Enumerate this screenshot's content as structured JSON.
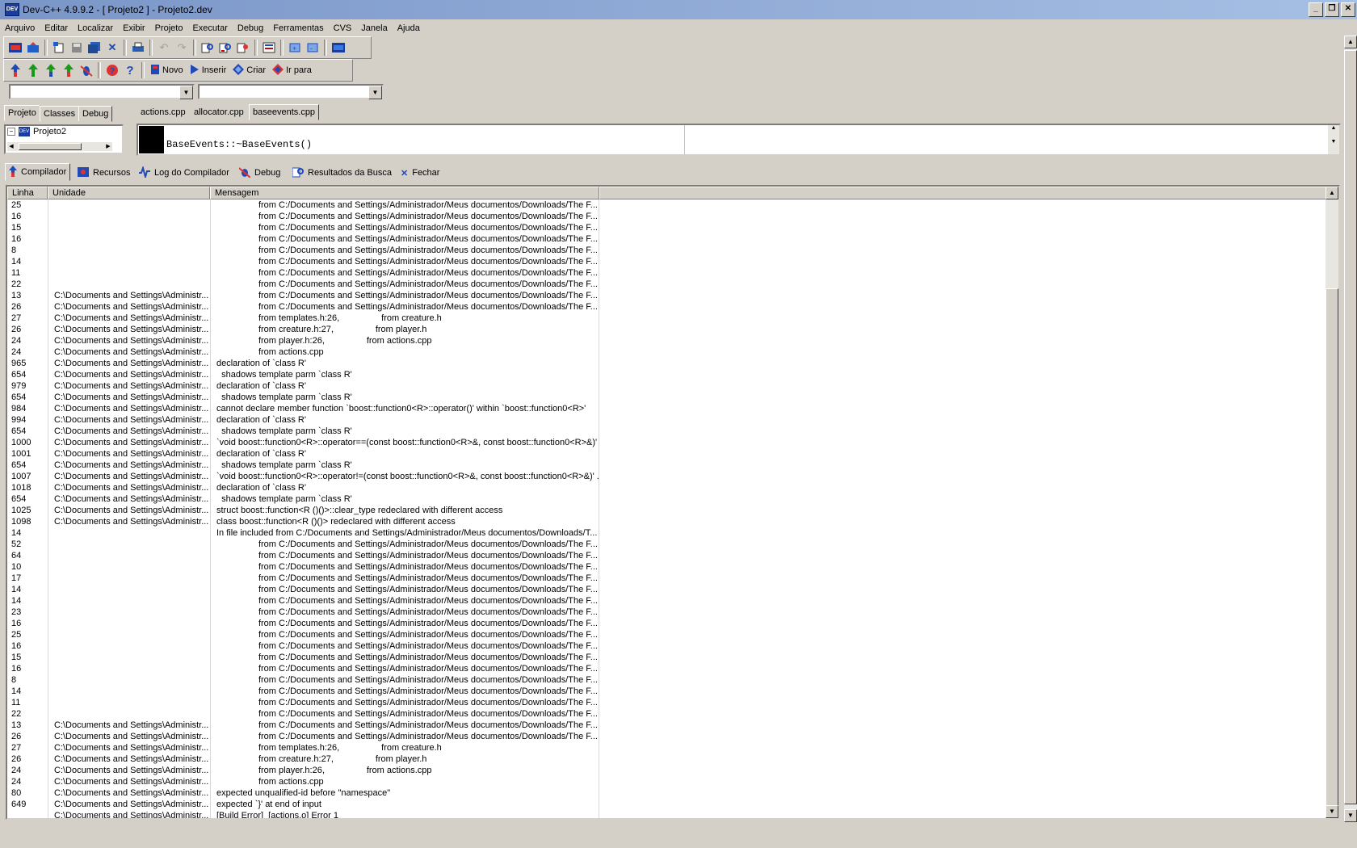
{
  "title": "Dev-C++ 4.9.9.2  -  [ Projeto2 ] - Projeto2.dev",
  "menu": [
    "Arquivo",
    "Editar",
    "Localizar",
    "Exibir",
    "Projeto",
    "Executar",
    "Debug",
    "Ferramentas",
    "CVS",
    "Janela",
    "Ajuda"
  ],
  "toolbar2": {
    "novo": "Novo",
    "inserir": "Inserir",
    "criar": "Criar",
    "ir_para": "Ir para"
  },
  "project_tabs": [
    "Projeto",
    "Classes",
    "Debug"
  ],
  "file_tabs": [
    "actions.cpp",
    "allocator.cpp",
    "baseevents.cpp"
  ],
  "tree": {
    "root": "Projeto2"
  },
  "editor": {
    "code": "BaseEvents::~BaseEvents()"
  },
  "bottom_tabs": [
    "Compilador",
    "Recursos",
    "Log do Compilador",
    "Debug",
    "Resultados da Busca",
    "Fechar"
  ],
  "grid": {
    "columns": [
      "Linha",
      "Unidade",
      "Mensagem"
    ],
    "rows": [
      [
        "25",
        "",
        "                 from C:/Documents and Settings/Administrador/Meus documentos/Downloads/The F..."
      ],
      [
        "16",
        "",
        "                 from C:/Documents and Settings/Administrador/Meus documentos/Downloads/The F..."
      ],
      [
        "15",
        "",
        "                 from C:/Documents and Settings/Administrador/Meus documentos/Downloads/The F..."
      ],
      [
        "16",
        "",
        "                 from C:/Documents and Settings/Administrador/Meus documentos/Downloads/The F..."
      ],
      [
        "8",
        "",
        "                 from C:/Documents and Settings/Administrador/Meus documentos/Downloads/The F..."
      ],
      [
        "14",
        "",
        "                 from C:/Documents and Settings/Administrador/Meus documentos/Downloads/The F..."
      ],
      [
        "11",
        "",
        "                 from C:/Documents and Settings/Administrador/Meus documentos/Downloads/The F..."
      ],
      [
        "22",
        "",
        "                 from C:/Documents and Settings/Administrador/Meus documentos/Downloads/The F..."
      ],
      [
        "13",
        "C:\\Documents and Settings\\Administr...",
        "                 from C:/Documents and Settings/Administrador/Meus documentos/Downloads/The F..."
      ],
      [
        "26",
        "C:\\Documents and Settings\\Administr...",
        "                 from C:/Documents and Settings/Administrador/Meus documentos/Downloads/The F..."
      ],
      [
        "27",
        "C:\\Documents and Settings\\Administr...",
        "                 from templates.h:26,                 from creature.h"
      ],
      [
        "26",
        "C:\\Documents and Settings\\Administr...",
        "                 from creature.h:27,                 from player.h"
      ],
      [
        "24",
        "C:\\Documents and Settings\\Administr...",
        "                 from player.h:26,                 from actions.cpp"
      ],
      [
        "24",
        "C:\\Documents and Settings\\Administr...",
        "                 from actions.cpp"
      ],
      [
        "965",
        "C:\\Documents and Settings\\Administr...",
        "declaration of `class R'"
      ],
      [
        "654",
        "C:\\Documents and Settings\\Administr...",
        "  shadows template parm `class R'"
      ],
      [
        "979",
        "C:\\Documents and Settings\\Administr...",
        "declaration of `class R'"
      ],
      [
        "654",
        "C:\\Documents and Settings\\Administr...",
        "  shadows template parm `class R'"
      ],
      [
        "984",
        "C:\\Documents and Settings\\Administr...",
        "cannot declare member function `boost::function0<R>::operator()' within `boost::function0<R>'"
      ],
      [
        "994",
        "C:\\Documents and Settings\\Administr...",
        "declaration of `class R'"
      ],
      [
        "654",
        "C:\\Documents and Settings\\Administr...",
        "  shadows template parm `class R'"
      ],
      [
        "1000",
        "C:\\Documents and Settings\\Administr...",
        "`void boost::function0<R>::operator==(const boost::function0<R>&, const boost::function0<R>&)' ..."
      ],
      [
        "1001",
        "C:\\Documents and Settings\\Administr...",
        "declaration of `class R'"
      ],
      [
        "654",
        "C:\\Documents and Settings\\Administr...",
        "  shadows template parm `class R'"
      ],
      [
        "1007",
        "C:\\Documents and Settings\\Administr...",
        "`void boost::function0<R>::operator!=(const boost::function0<R>&, const boost::function0<R>&)' ..."
      ],
      [
        "1018",
        "C:\\Documents and Settings\\Administr...",
        "declaration of `class R'"
      ],
      [
        "654",
        "C:\\Documents and Settings\\Administr...",
        "  shadows template parm `class R'"
      ],
      [
        "1025",
        "C:\\Documents and Settings\\Administr...",
        "struct boost::function<R ()()>::clear_type redeclared with different access"
      ],
      [
        "1098",
        "C:\\Documents and Settings\\Administr...",
        "class boost::function<R ()()> redeclared with different access"
      ],
      [
        "14",
        "",
        "In file included from C:/Documents and Settings/Administrador/Meus documentos/Downloads/T..."
      ],
      [
        "52",
        "",
        "                 from C:/Documents and Settings/Administrador/Meus documentos/Downloads/The F..."
      ],
      [
        "64",
        "",
        "                 from C:/Documents and Settings/Administrador/Meus documentos/Downloads/The F..."
      ],
      [
        "10",
        "",
        "                 from C:/Documents and Settings/Administrador/Meus documentos/Downloads/The F..."
      ],
      [
        "17",
        "",
        "                 from C:/Documents and Settings/Administrador/Meus documentos/Downloads/The F..."
      ],
      [
        "14",
        "",
        "                 from C:/Documents and Settings/Administrador/Meus documentos/Downloads/The F..."
      ],
      [
        "14",
        "",
        "                 from C:/Documents and Settings/Administrador/Meus documentos/Downloads/The F..."
      ],
      [
        "23",
        "",
        "                 from C:/Documents and Settings/Administrador/Meus documentos/Downloads/The F..."
      ],
      [
        "16",
        "",
        "                 from C:/Documents and Settings/Administrador/Meus documentos/Downloads/The F..."
      ],
      [
        "25",
        "",
        "                 from C:/Documents and Settings/Administrador/Meus documentos/Downloads/The F..."
      ],
      [
        "16",
        "",
        "                 from C:/Documents and Settings/Administrador/Meus documentos/Downloads/The F..."
      ],
      [
        "15",
        "",
        "                 from C:/Documents and Settings/Administrador/Meus documentos/Downloads/The F..."
      ],
      [
        "16",
        "",
        "                 from C:/Documents and Settings/Administrador/Meus documentos/Downloads/The F..."
      ],
      [
        "8",
        "",
        "                 from C:/Documents and Settings/Administrador/Meus documentos/Downloads/The F..."
      ],
      [
        "14",
        "",
        "                 from C:/Documents and Settings/Administrador/Meus documentos/Downloads/The F..."
      ],
      [
        "11",
        "",
        "                 from C:/Documents and Settings/Administrador/Meus documentos/Downloads/The F..."
      ],
      [
        "22",
        "",
        "                 from C:/Documents and Settings/Administrador/Meus documentos/Downloads/The F..."
      ],
      [
        "13",
        "C:\\Documents and Settings\\Administr...",
        "                 from C:/Documents and Settings/Administrador/Meus documentos/Downloads/The F..."
      ],
      [
        "26",
        "C:\\Documents and Settings\\Administr...",
        "                 from C:/Documents and Settings/Administrador/Meus documentos/Downloads/The F..."
      ],
      [
        "27",
        "C:\\Documents and Settings\\Administr...",
        "                 from templates.h:26,                 from creature.h"
      ],
      [
        "26",
        "C:\\Documents and Settings\\Administr...",
        "                 from creature.h:27,                 from player.h"
      ],
      [
        "24",
        "C:\\Documents and Settings\\Administr...",
        "                 from player.h:26,                 from actions.cpp"
      ],
      [
        "24",
        "C:\\Documents and Settings\\Administr...",
        "                 from actions.cpp"
      ],
      [
        "80",
        "C:\\Documents and Settings\\Administr...",
        "expected unqualified-id before \"namespace\""
      ],
      [
        "649",
        "C:\\Documents and Settings\\Administr...",
        "expected `}' at end of input"
      ],
      [
        "",
        "C:\\Documents and Settings\\Administr...",
        "[Build Error]  [actions.o] Error 1"
      ]
    ]
  },
  "colors": {
    "face": "#d4d0c8",
    "title_gradient_start": "#7a96c8",
    "title_gradient_end": "#a6bfe4"
  }
}
